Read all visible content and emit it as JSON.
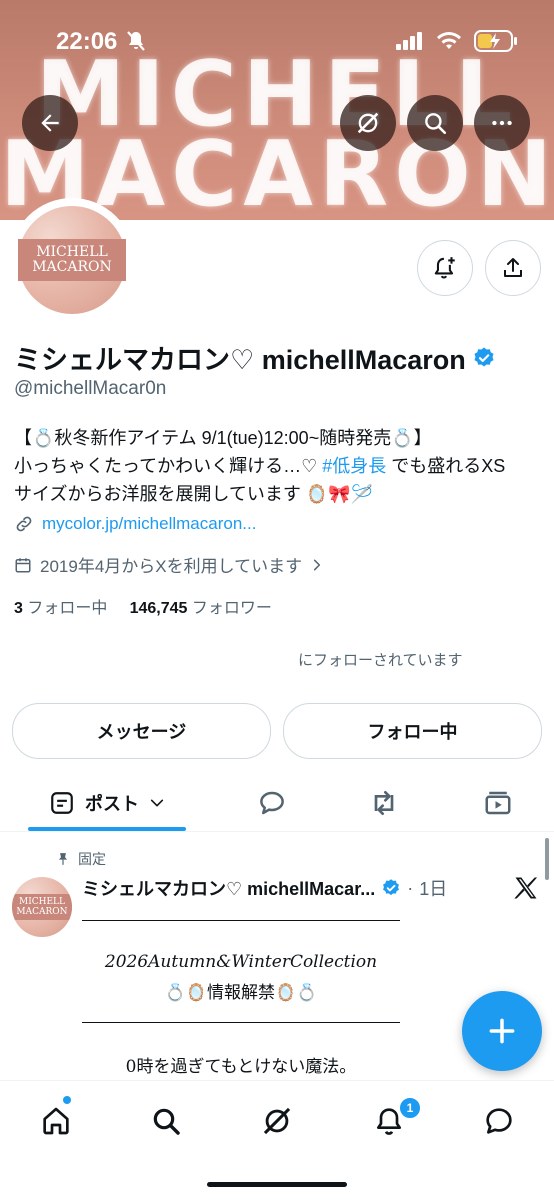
{
  "status_bar": {
    "time": "22:06"
  },
  "banner": {
    "line1": "MICHELL",
    "line2": "MACARON"
  },
  "avatar": {
    "line1": "MICHELL",
    "line2": "MACARON"
  },
  "profile": {
    "display_name": "ミシェルマカロン♡ michellMacaron",
    "handle": "@michellMacar0n",
    "bio_line1": "【💍秋冬新作アイテム 9/1(tue)12:00~随時発売💍】",
    "bio_line2_a": "小っちゃくたってかわいく輝ける…♡ ",
    "bio_hashtag": "#低身長",
    "bio_line2_b": " でも盛れるXS",
    "bio_line3": "サイズからお洋服を展開しています 🪞🎀🪡",
    "link": "mycolor.jp/michellmacaron...",
    "joined": "2019年4月からXを利用しています",
    "following_count": "3",
    "following_label": "フォロー中",
    "followers_count": "146,745",
    "followers_label": "フォロワー",
    "followed_by": "にフォローされています"
  },
  "actions": {
    "message": "メッセージ",
    "following": "フォロー中"
  },
  "tabs": {
    "posts": "ポスト"
  },
  "post": {
    "pinned_label": "固定",
    "author": "ミシェルマカロン♡ michellMacar...",
    "time": "1日",
    "line_collection": "2026Autumn&WinterCollection",
    "line_announce": "💍🪞情報解禁🪞💍",
    "line_magic": "0時を過ぎてもとけない魔法。"
  },
  "notifications": {
    "badge": "1"
  },
  "colors": {
    "accent": "#1d9bf0",
    "banner": "#cf8c7b",
    "text": "#0f1419",
    "muted": "#536471"
  },
  "icons": [
    "back-arrow-icon",
    "grok-icon",
    "search-icon",
    "more-icon",
    "notification-bell-icon",
    "share-icon",
    "verified-icon",
    "link-icon",
    "calendar-icon",
    "chevron-right-icon",
    "pin-icon",
    "x-logo-icon",
    "plus-icon",
    "home-icon",
    "bell-icon",
    "messages-icon"
  ]
}
